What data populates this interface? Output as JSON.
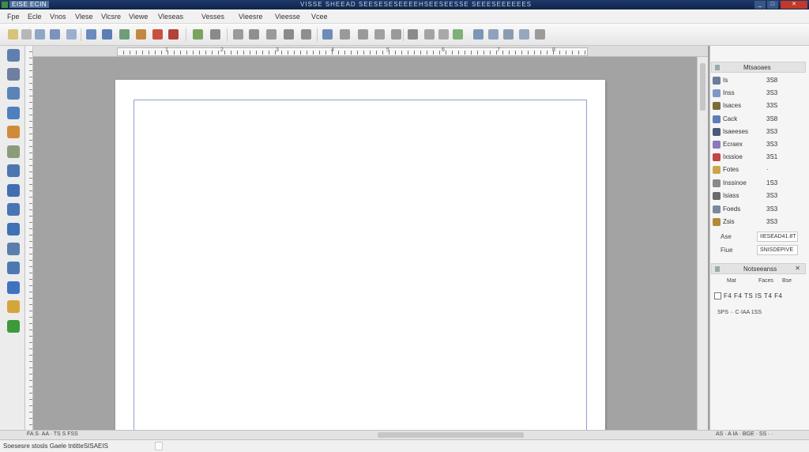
{
  "title_bar": {
    "app_title": "EISE ECIN",
    "doc_title": "VISSE SHEEAD SEESESESEEEEHSEESEESSE SEEESEEEEEES",
    "minimize": "_",
    "maximize": "□",
    "close": "✕"
  },
  "menu": {
    "items": [
      "Fpe",
      "Ecle",
      "Vnos",
      "Vlese",
      "Vlcsre",
      "Viewe",
      "Vleseas",
      "Vesses",
      "Vieesre",
      "Vieesse",
      "Vcee"
    ]
  },
  "ruler": {
    "labels": [
      "1",
      "2",
      "3",
      "4",
      "5",
      "6",
      "7",
      "8"
    ]
  },
  "layers_panel": {
    "title": "Mtsaoaes",
    "rows": [
      {
        "name": "Is",
        "count": "3S8",
        "color": "#6a7d9c"
      },
      {
        "name": "Inss",
        "count": "3S3",
        "color": "#7f97c2"
      },
      {
        "name": "Isaces",
        "count": "33S",
        "color": "#7b6a3a"
      },
      {
        "name": "Cack",
        "count": "3S8",
        "color": "#5d7fb7"
      },
      {
        "name": "Isaeeses",
        "count": "3S3",
        "color": "#4a5a7a"
      },
      {
        "name": "Ecraex",
        "count": "3S3",
        "color": "#8b79b8"
      },
      {
        "name": "Ixssioe",
        "count": "3S1",
        "color": "#c04646"
      },
      {
        "name": "Fotes",
        "count": "·",
        "color": "#c9a64a"
      },
      {
        "name": "Inssinoe",
        "count": "1S3",
        "color": "#8a8a8a"
      },
      {
        "name": "Isiass",
        "count": "3S3",
        "color": "#6a6a6a"
      },
      {
        "name": "Foeds",
        "count": "3S3",
        "color": "#7a8a9a"
      },
      {
        "name": "Zsis",
        "count": "3S3",
        "color": "#b28a3a"
      }
    ],
    "fields": [
      {
        "label": "Ase",
        "value": "IIESEAD41.8T"
      },
      {
        "label": "Fiue",
        "value": "SNISDEPIVE"
      }
    ]
  },
  "props_panel": {
    "title": "Notseeanss",
    "columns": [
      "Mat",
      "Faces",
      "Bse"
    ],
    "cells": "F4  F4  TS  IS  T4  F4",
    "line": "SPS ·· C·IAA 1SS"
  },
  "bottom_bar": {
    "page_info": "FA S· AA · TS S FSS",
    "panel_foot": "AS · A IA · BGE · SS · ·"
  },
  "status": {
    "text": "Soesesre stosls Gaele tntitteSISAEIS"
  }
}
